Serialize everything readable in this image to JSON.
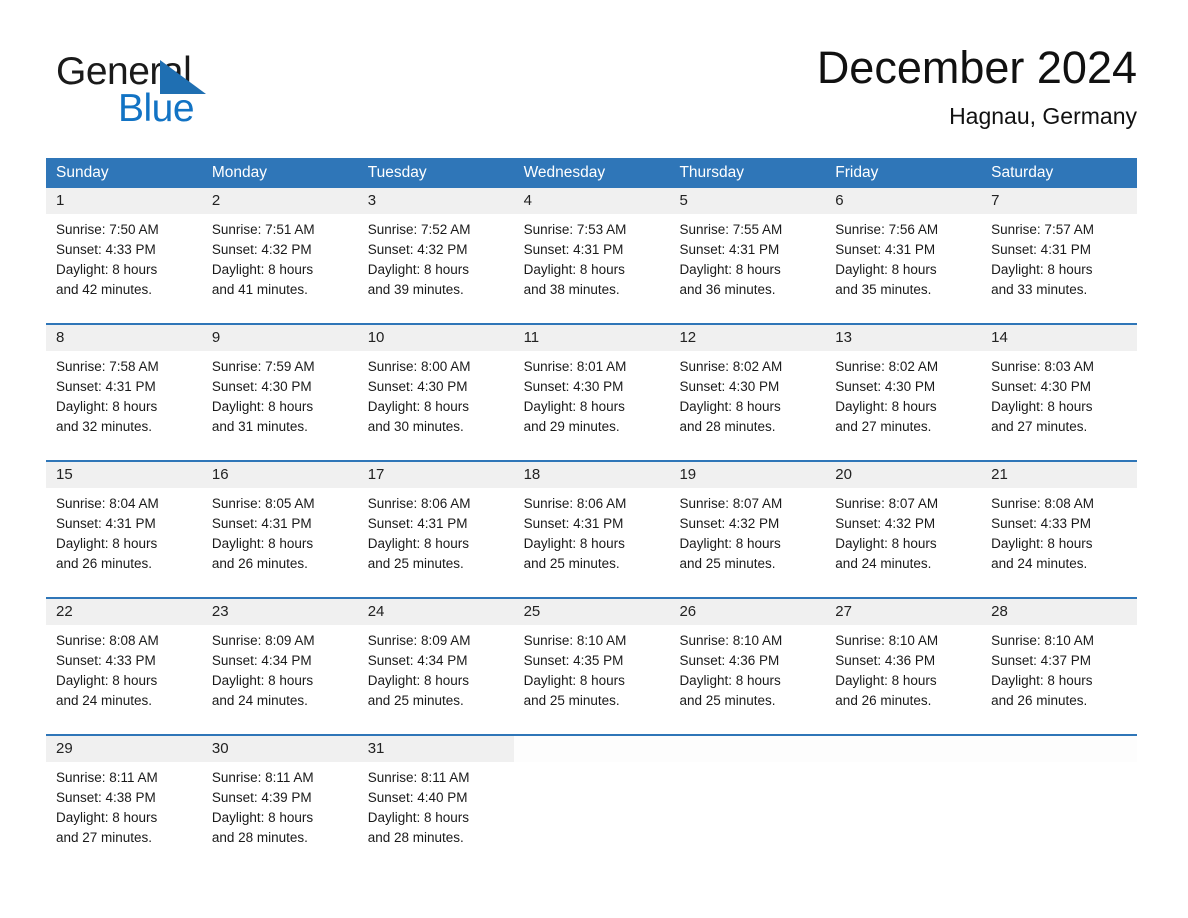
{
  "brand": {
    "name_top": "General",
    "name_bottom": "Blue",
    "triangle_icon": "brand-triangle-icon",
    "color_black": "#1a1a1a",
    "color_blue": "#1273c4"
  },
  "header": {
    "title": "December 2024",
    "subtitle": "Hagnau, Germany"
  },
  "theme": {
    "header_blue": "#2f76b8",
    "date_strip_gray": "#f0f0f0",
    "text": "#1a1a1a"
  },
  "weekdays": [
    "Sunday",
    "Monday",
    "Tuesday",
    "Wednesday",
    "Thursday",
    "Friday",
    "Saturday"
  ],
  "weeks": [
    {
      "dates": [
        "1",
        "2",
        "3",
        "4",
        "5",
        "6",
        "7"
      ],
      "cells": [
        {
          "sunrise": "Sunrise: 7:50 AM",
          "sunset": "Sunset: 4:33 PM",
          "daylight1": "Daylight: 8 hours",
          "daylight2": "and 42 minutes."
        },
        {
          "sunrise": "Sunrise: 7:51 AM",
          "sunset": "Sunset: 4:32 PM",
          "daylight1": "Daylight: 8 hours",
          "daylight2": "and 41 minutes."
        },
        {
          "sunrise": "Sunrise: 7:52 AM",
          "sunset": "Sunset: 4:32 PM",
          "daylight1": "Daylight: 8 hours",
          "daylight2": "and 39 minutes."
        },
        {
          "sunrise": "Sunrise: 7:53 AM",
          "sunset": "Sunset: 4:31 PM",
          "daylight1": "Daylight: 8 hours",
          "daylight2": "and 38 minutes."
        },
        {
          "sunrise": "Sunrise: 7:55 AM",
          "sunset": "Sunset: 4:31 PM",
          "daylight1": "Daylight: 8 hours",
          "daylight2": "and 36 minutes."
        },
        {
          "sunrise": "Sunrise: 7:56 AM",
          "sunset": "Sunset: 4:31 PM",
          "daylight1": "Daylight: 8 hours",
          "daylight2": "and 35 minutes."
        },
        {
          "sunrise": "Sunrise: 7:57 AM",
          "sunset": "Sunset: 4:31 PM",
          "daylight1": "Daylight: 8 hours",
          "daylight2": "and 33 minutes."
        }
      ]
    },
    {
      "dates": [
        "8",
        "9",
        "10",
        "11",
        "12",
        "13",
        "14"
      ],
      "cells": [
        {
          "sunrise": "Sunrise: 7:58 AM",
          "sunset": "Sunset: 4:31 PM",
          "daylight1": "Daylight: 8 hours",
          "daylight2": "and 32 minutes."
        },
        {
          "sunrise": "Sunrise: 7:59 AM",
          "sunset": "Sunset: 4:30 PM",
          "daylight1": "Daylight: 8 hours",
          "daylight2": "and 31 minutes."
        },
        {
          "sunrise": "Sunrise: 8:00 AM",
          "sunset": "Sunset: 4:30 PM",
          "daylight1": "Daylight: 8 hours",
          "daylight2": "and 30 minutes."
        },
        {
          "sunrise": "Sunrise: 8:01 AM",
          "sunset": "Sunset: 4:30 PM",
          "daylight1": "Daylight: 8 hours",
          "daylight2": "and 29 minutes."
        },
        {
          "sunrise": "Sunrise: 8:02 AM",
          "sunset": "Sunset: 4:30 PM",
          "daylight1": "Daylight: 8 hours",
          "daylight2": "and 28 minutes."
        },
        {
          "sunrise": "Sunrise: 8:02 AM",
          "sunset": "Sunset: 4:30 PM",
          "daylight1": "Daylight: 8 hours",
          "daylight2": "and 27 minutes."
        },
        {
          "sunrise": "Sunrise: 8:03 AM",
          "sunset": "Sunset: 4:30 PM",
          "daylight1": "Daylight: 8 hours",
          "daylight2": "and 27 minutes."
        }
      ]
    },
    {
      "dates": [
        "15",
        "16",
        "17",
        "18",
        "19",
        "20",
        "21"
      ],
      "cells": [
        {
          "sunrise": "Sunrise: 8:04 AM",
          "sunset": "Sunset: 4:31 PM",
          "daylight1": "Daylight: 8 hours",
          "daylight2": "and 26 minutes."
        },
        {
          "sunrise": "Sunrise: 8:05 AM",
          "sunset": "Sunset: 4:31 PM",
          "daylight1": "Daylight: 8 hours",
          "daylight2": "and 26 minutes."
        },
        {
          "sunrise": "Sunrise: 8:06 AM",
          "sunset": "Sunset: 4:31 PM",
          "daylight1": "Daylight: 8 hours",
          "daylight2": "and 25 minutes."
        },
        {
          "sunrise": "Sunrise: 8:06 AM",
          "sunset": "Sunset: 4:31 PM",
          "daylight1": "Daylight: 8 hours",
          "daylight2": "and 25 minutes."
        },
        {
          "sunrise": "Sunrise: 8:07 AM",
          "sunset": "Sunset: 4:32 PM",
          "daylight1": "Daylight: 8 hours",
          "daylight2": "and 25 minutes."
        },
        {
          "sunrise": "Sunrise: 8:07 AM",
          "sunset": "Sunset: 4:32 PM",
          "daylight1": "Daylight: 8 hours",
          "daylight2": "and 24 minutes."
        },
        {
          "sunrise": "Sunrise: 8:08 AM",
          "sunset": "Sunset: 4:33 PM",
          "daylight1": "Daylight: 8 hours",
          "daylight2": "and 24 minutes."
        }
      ]
    },
    {
      "dates": [
        "22",
        "23",
        "24",
        "25",
        "26",
        "27",
        "28"
      ],
      "cells": [
        {
          "sunrise": "Sunrise: 8:08 AM",
          "sunset": "Sunset: 4:33 PM",
          "daylight1": "Daylight: 8 hours",
          "daylight2": "and 24 minutes."
        },
        {
          "sunrise": "Sunrise: 8:09 AM",
          "sunset": "Sunset: 4:34 PM",
          "daylight1": "Daylight: 8 hours",
          "daylight2": "and 24 minutes."
        },
        {
          "sunrise": "Sunrise: 8:09 AM",
          "sunset": "Sunset: 4:34 PM",
          "daylight1": "Daylight: 8 hours",
          "daylight2": "and 25 minutes."
        },
        {
          "sunrise": "Sunrise: 8:10 AM",
          "sunset": "Sunset: 4:35 PM",
          "daylight1": "Daylight: 8 hours",
          "daylight2": "and 25 minutes."
        },
        {
          "sunrise": "Sunrise: 8:10 AM",
          "sunset": "Sunset: 4:36 PM",
          "daylight1": "Daylight: 8 hours",
          "daylight2": "and 25 minutes."
        },
        {
          "sunrise": "Sunrise: 8:10 AM",
          "sunset": "Sunset: 4:36 PM",
          "daylight1": "Daylight: 8 hours",
          "daylight2": "and 26 minutes."
        },
        {
          "sunrise": "Sunrise: 8:10 AM",
          "sunset": "Sunset: 4:37 PM",
          "daylight1": "Daylight: 8 hours",
          "daylight2": "and 26 minutes."
        }
      ]
    },
    {
      "dates": [
        "29",
        "30",
        "31",
        "",
        "",
        "",
        ""
      ],
      "cells": [
        {
          "sunrise": "Sunrise: 8:11 AM",
          "sunset": "Sunset: 4:38 PM",
          "daylight1": "Daylight: 8 hours",
          "daylight2": "and 27 minutes."
        },
        {
          "sunrise": "Sunrise: 8:11 AM",
          "sunset": "Sunset: 4:39 PM",
          "daylight1": "Daylight: 8 hours",
          "daylight2": "and 28 minutes."
        },
        {
          "sunrise": "Sunrise: 8:11 AM",
          "sunset": "Sunset: 4:40 PM",
          "daylight1": "Daylight: 8 hours",
          "daylight2": "and 28 minutes."
        },
        {
          "sunrise": "",
          "sunset": "",
          "daylight1": "",
          "daylight2": ""
        },
        {
          "sunrise": "",
          "sunset": "",
          "daylight1": "",
          "daylight2": ""
        },
        {
          "sunrise": "",
          "sunset": "",
          "daylight1": "",
          "daylight2": ""
        },
        {
          "sunrise": "",
          "sunset": "",
          "daylight1": "",
          "daylight2": ""
        }
      ]
    }
  ]
}
